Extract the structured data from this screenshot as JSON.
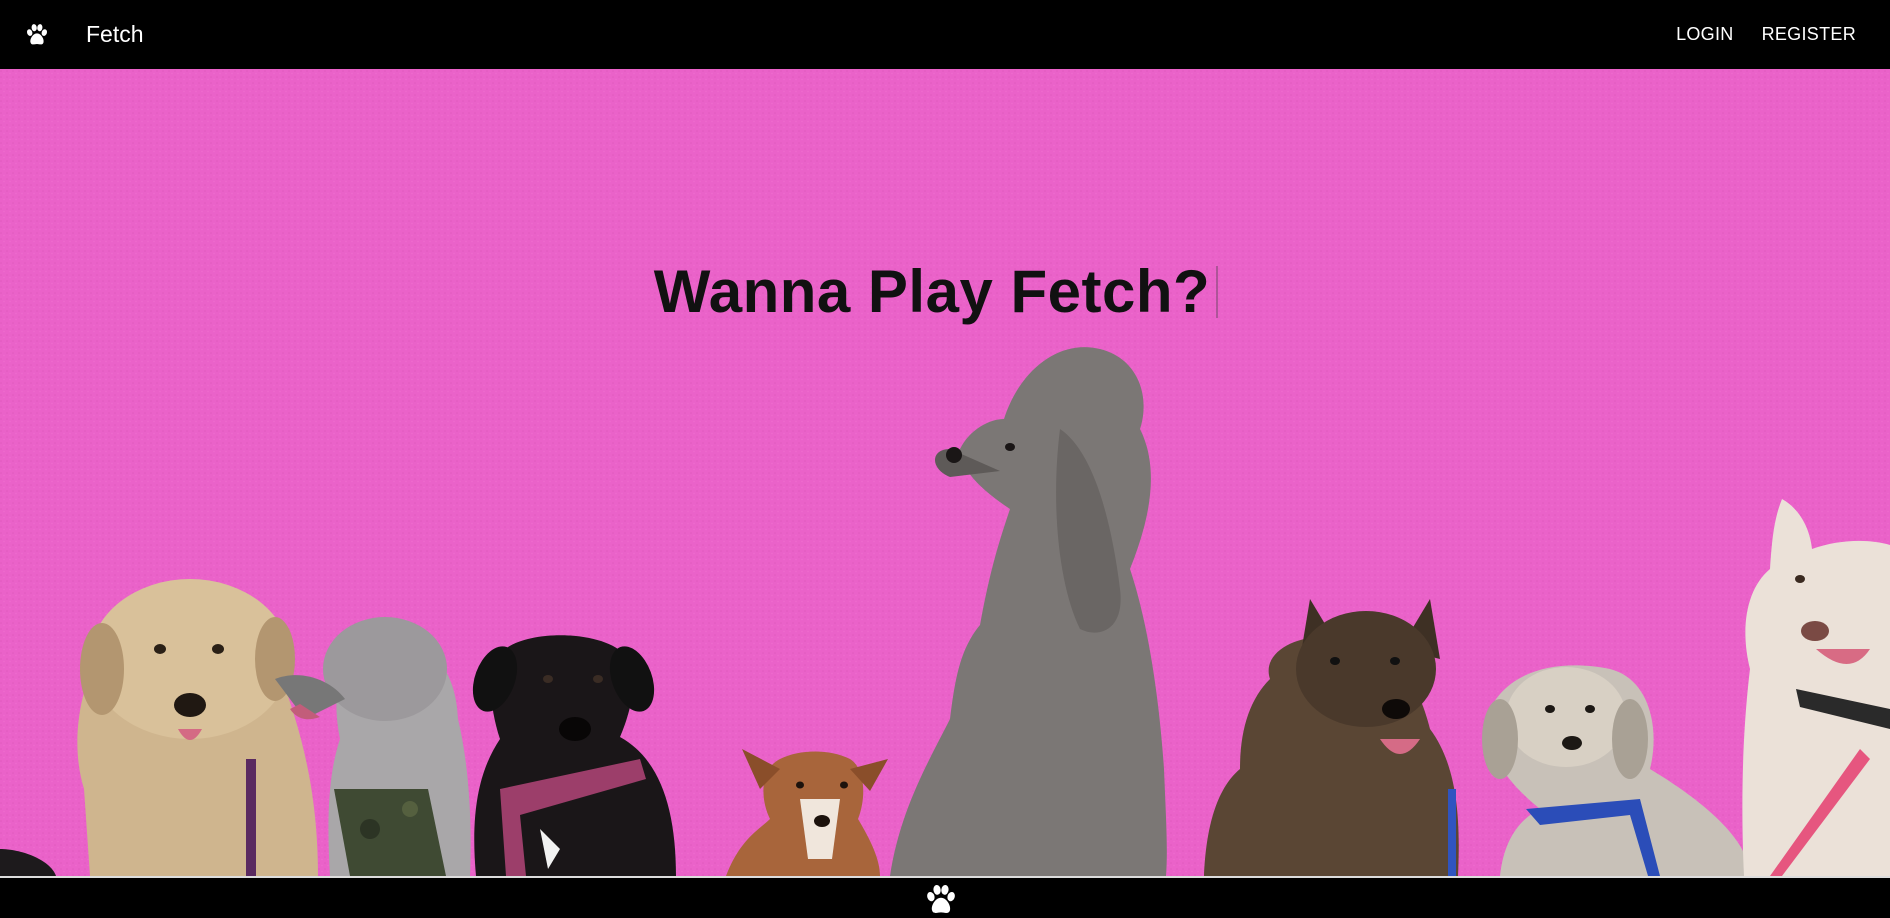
{
  "app": {
    "title": "Fetch",
    "logo_icon": "paw-icon"
  },
  "nav": {
    "login_label": "LOGIN",
    "register_label": "REGISTER"
  },
  "hero": {
    "heading": "Wanna Play Fetch?",
    "background_color": "#ea62c9",
    "image_description_icon": "dogs-photo"
  },
  "footer": {
    "icon": "paw-icon"
  },
  "colors": {
    "bar": "#000000",
    "text_light": "#ffffff",
    "heading": "#111111"
  }
}
